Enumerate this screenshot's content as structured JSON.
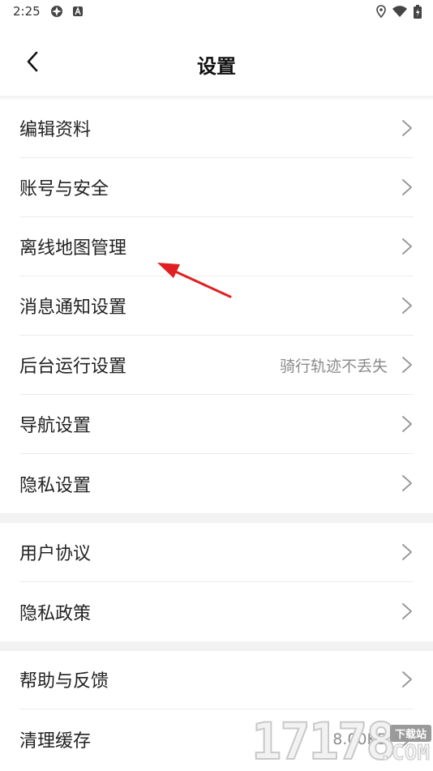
{
  "status_bar": {
    "time": "2:25",
    "icons": [
      "app-icon",
      "a-badge-icon",
      "location-icon",
      "wifi-icon",
      "battery-icon"
    ]
  },
  "header": {
    "title": "设置",
    "back_icon": "chevron-left-icon"
  },
  "groups": [
    {
      "items": [
        {
          "label": "编辑资料",
          "value": ""
        },
        {
          "label": "账号与安全",
          "value": ""
        },
        {
          "label": "离线地图管理",
          "value": ""
        },
        {
          "label": "消息通知设置",
          "value": ""
        },
        {
          "label": "后台运行设置",
          "value": "骑行轨迹不丢失"
        },
        {
          "label": "导航设置",
          "value": ""
        },
        {
          "label": "隐私设置",
          "value": ""
        }
      ]
    },
    {
      "items": [
        {
          "label": "用户协议",
          "value": ""
        },
        {
          "label": "隐私政策",
          "value": ""
        }
      ]
    },
    {
      "items": [
        {
          "label": "帮助与反馈",
          "value": ""
        },
        {
          "label": "清理缓存",
          "value": "8.00KB"
        }
      ]
    }
  ],
  "annotation": {
    "arrow_color": "#e02020"
  },
  "watermark": {
    "digits": "17178",
    "tag": "下载站",
    "suffix": ".COM"
  },
  "colors": {
    "background": "#ffffff",
    "divider": "#ececec",
    "section_gap": "#f2f2f2",
    "chevron": "#9a9a9a"
  }
}
